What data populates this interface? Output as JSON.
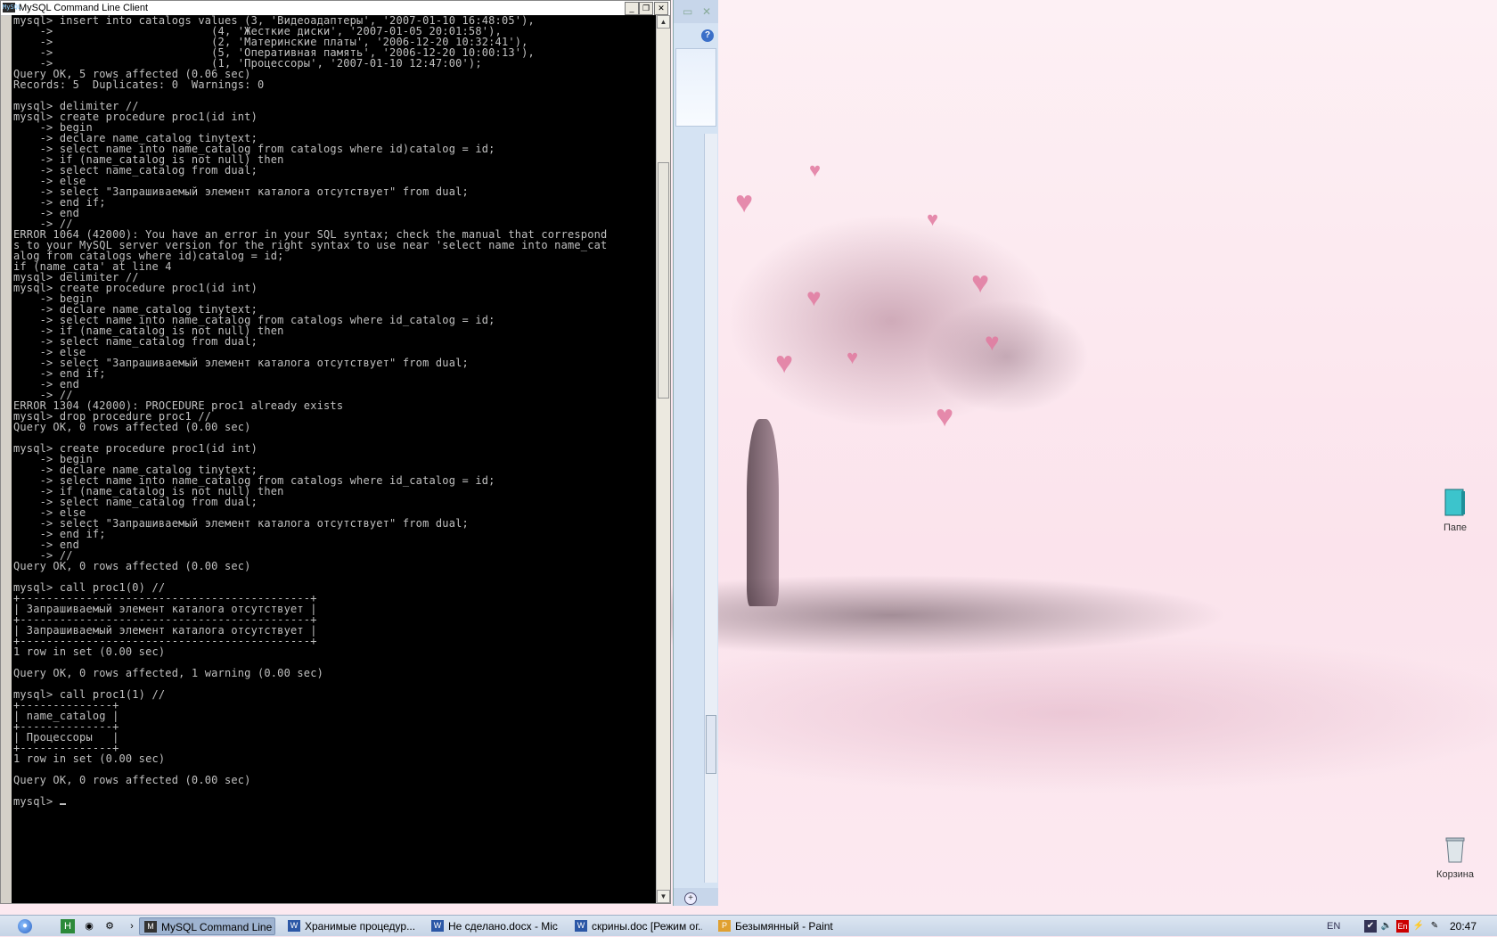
{
  "console": {
    "title": "MySQL Command Line Client",
    "lines": [
      "mysql> insert into catalogs values (3, 'Видеоадаптеры', '2007-01-10 16:48:05'),",
      "    ->                        (4, 'Жесткие диски', '2007-01-05 20:01:58'),",
      "    ->                        (2, 'Материнские платы', '2006-12-20 10:32:41'),",
      "    ->                        (5, 'Оперативная память', '2006-12-20 10:00:13'),",
      "    ->                        (1, 'Процессоры', '2007-01-10 12:47:00');",
      "Query OK, 5 rows affected (0.06 sec)",
      "Records: 5  Duplicates: 0  Warnings: 0",
      "",
      "mysql> delimiter //",
      "mysql> create procedure proc1(id int)",
      "    -> begin",
      "    -> declare name_catalog tinytext;",
      "    -> select name into name_catalog from catalogs where id)catalog = id;",
      "    -> if (name_catalog is not null) then",
      "    -> select name_catalog from dual;",
      "    -> else",
      "    -> select \"Запрашиваемый элемент каталога отсутствует\" from dual;",
      "    -> end if;",
      "    -> end",
      "    -> //",
      "ERROR 1064 (42000): You have an error in your SQL syntax; check the manual that correspond",
      "s to your MySQL server version for the right syntax to use near 'select name into name_cat",
      "alog from catalogs where id)catalog = id;",
      "if (name_cata' at line 4",
      "mysql> delimiter //",
      "mysql> create procedure proc1(id int)",
      "    -> begin",
      "    -> declare name_catalog tinytext;",
      "    -> select name into name_catalog from catalogs where id_catalog = id;",
      "    -> if (name_catalog is not null) then",
      "    -> select name_catalog from dual;",
      "    -> else",
      "    -> select \"Запрашиваемый элемент каталога отсутствует\" from dual;",
      "    -> end if;",
      "    -> end",
      "    -> //",
      "ERROR 1304 (42000): PROCEDURE proc1 already exists",
      "mysql> drop procedure proc1 //",
      "Query OK, 0 rows affected (0.00 sec)",
      "",
      "mysql> create procedure proc1(id int)",
      "    -> begin",
      "    -> declare name_catalog tinytext;",
      "    -> select name into name_catalog from catalogs where id_catalog = id;",
      "    -> if (name_catalog is not null) then",
      "    -> select name_catalog from dual;",
      "    -> else",
      "    -> select \"Запрашиваемый элемент каталога отсутствует\" from dual;",
      "    -> end if;",
      "    -> end",
      "    -> //",
      "Query OK, 0 rows affected (0.00 sec)",
      "",
      "mysql> call proc1(0) //",
      "+--------------------------------------------+",
      "| Запрашиваемый элемент каталога отсутствует |",
      "+--------------------------------------------+",
      "| Запрашиваемый элемент каталога отсутствует |",
      "+--------------------------------------------+",
      "1 row in set (0.00 sec)",
      "",
      "Query OK, 0 rows affected, 1 warning (0.00 sec)",
      "",
      "mysql> call proc1(1) //",
      "+--------------+",
      "| name_catalog |",
      "+--------------+",
      "| Процессоры   |",
      "+--------------+",
      "1 row in set (0.00 sec)",
      "",
      "Query OK, 0 rows affected (0.00 sec)",
      ""
    ],
    "prompt": "mysql> "
  },
  "desktop_icons": [
    {
      "label": "Папе",
      "icon": "folder-book-icon"
    },
    {
      "label": "Корзина",
      "icon": "recycle-bin-icon"
    }
  ],
  "taskbar": {
    "tasks": [
      {
        "label": "MySQL Command Line ...",
        "icon": "mysql-icon",
        "active": true
      },
      {
        "label": "Хранимые процедур...",
        "icon": "word-icon",
        "active": false
      },
      {
        "label": "Не сделано.docx - Mic...",
        "icon": "word-icon",
        "active": false
      },
      {
        "label": "скрины.doc [Режим ог...",
        "icon": "word-icon",
        "active": false
      },
      {
        "label": "Безымянный - Paint",
        "icon": "paint-icon",
        "active": false
      }
    ],
    "lang": "EN",
    "clock": "20:47"
  },
  "colors": {
    "console_bg": "#000000",
    "console_fg": "#c0c0c0",
    "wallpaper": "#fbe6ee",
    "taskbar": "#c6d4e6"
  }
}
